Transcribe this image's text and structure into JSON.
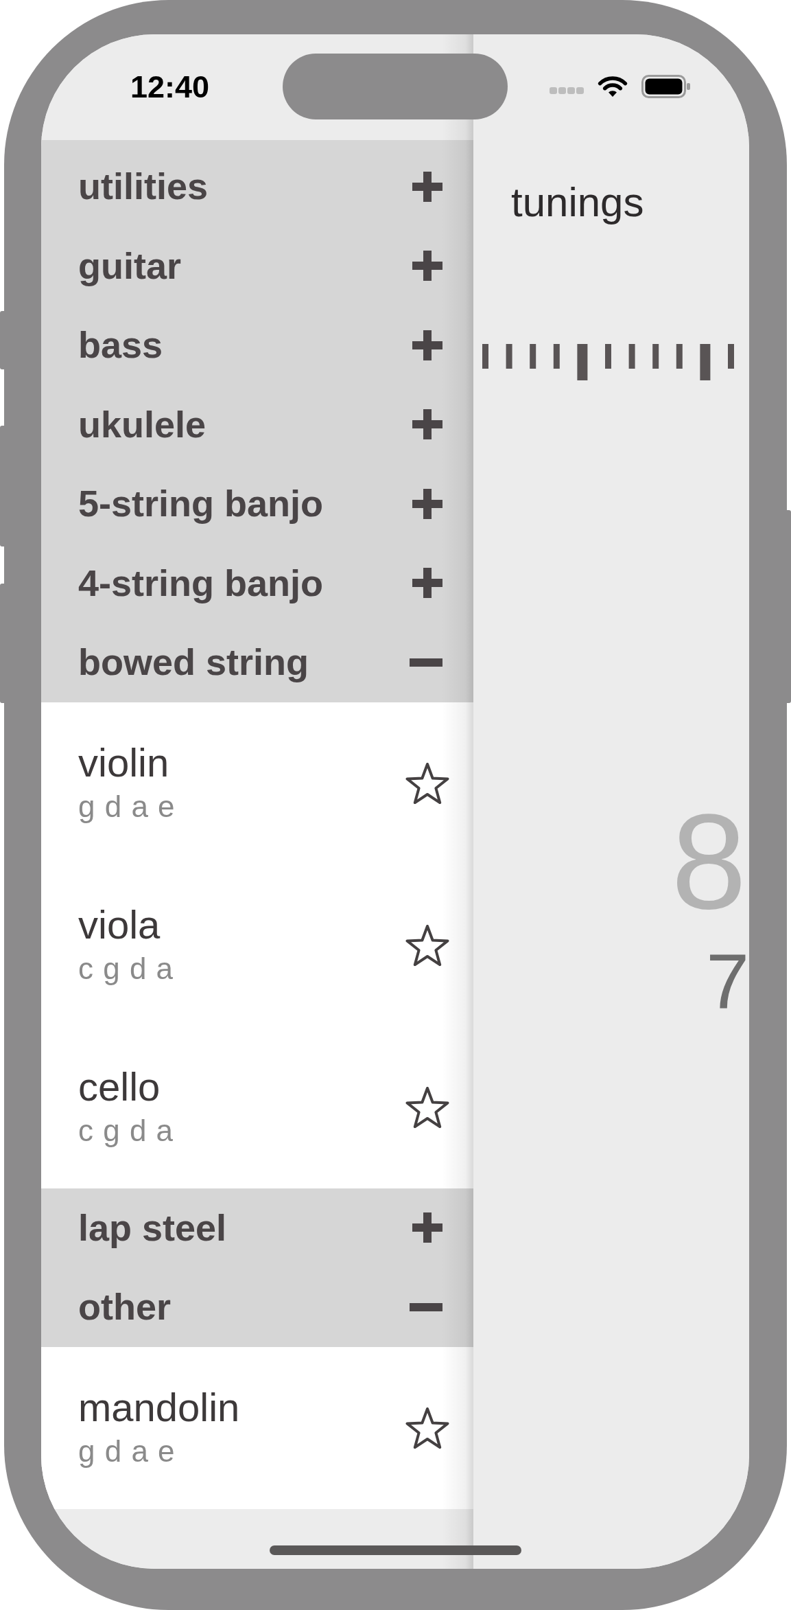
{
  "status_bar": {
    "time": "12:40"
  },
  "drawer": {
    "categories": [
      {
        "label": "utilities",
        "expanded": false
      },
      {
        "label": "guitar",
        "expanded": false
      },
      {
        "label": "bass",
        "expanded": false
      },
      {
        "label": "ukulele",
        "expanded": false
      },
      {
        "label": "5-string banjo",
        "expanded": false
      },
      {
        "label": "4-string banjo",
        "expanded": false
      },
      {
        "label": "bowed string",
        "expanded": true,
        "tunings": [
          {
            "name": "violin",
            "notes": "g d a e",
            "favorite": false
          },
          {
            "name": "viola",
            "notes": "c g d a",
            "favorite": false
          },
          {
            "name": "cello",
            "notes": "c g d a",
            "favorite": false
          }
        ]
      },
      {
        "label": "lap steel",
        "expanded": false
      },
      {
        "label": "other",
        "expanded": true,
        "tunings": [
          {
            "name": "mandolin",
            "notes": "g d a e",
            "favorite": false
          }
        ]
      }
    ]
  },
  "main": {
    "title": "tunings",
    "dial": [
      {
        "value": "8",
        "kind": "current"
      },
      {
        "value": "7",
        "kind": "next"
      }
    ]
  }
}
